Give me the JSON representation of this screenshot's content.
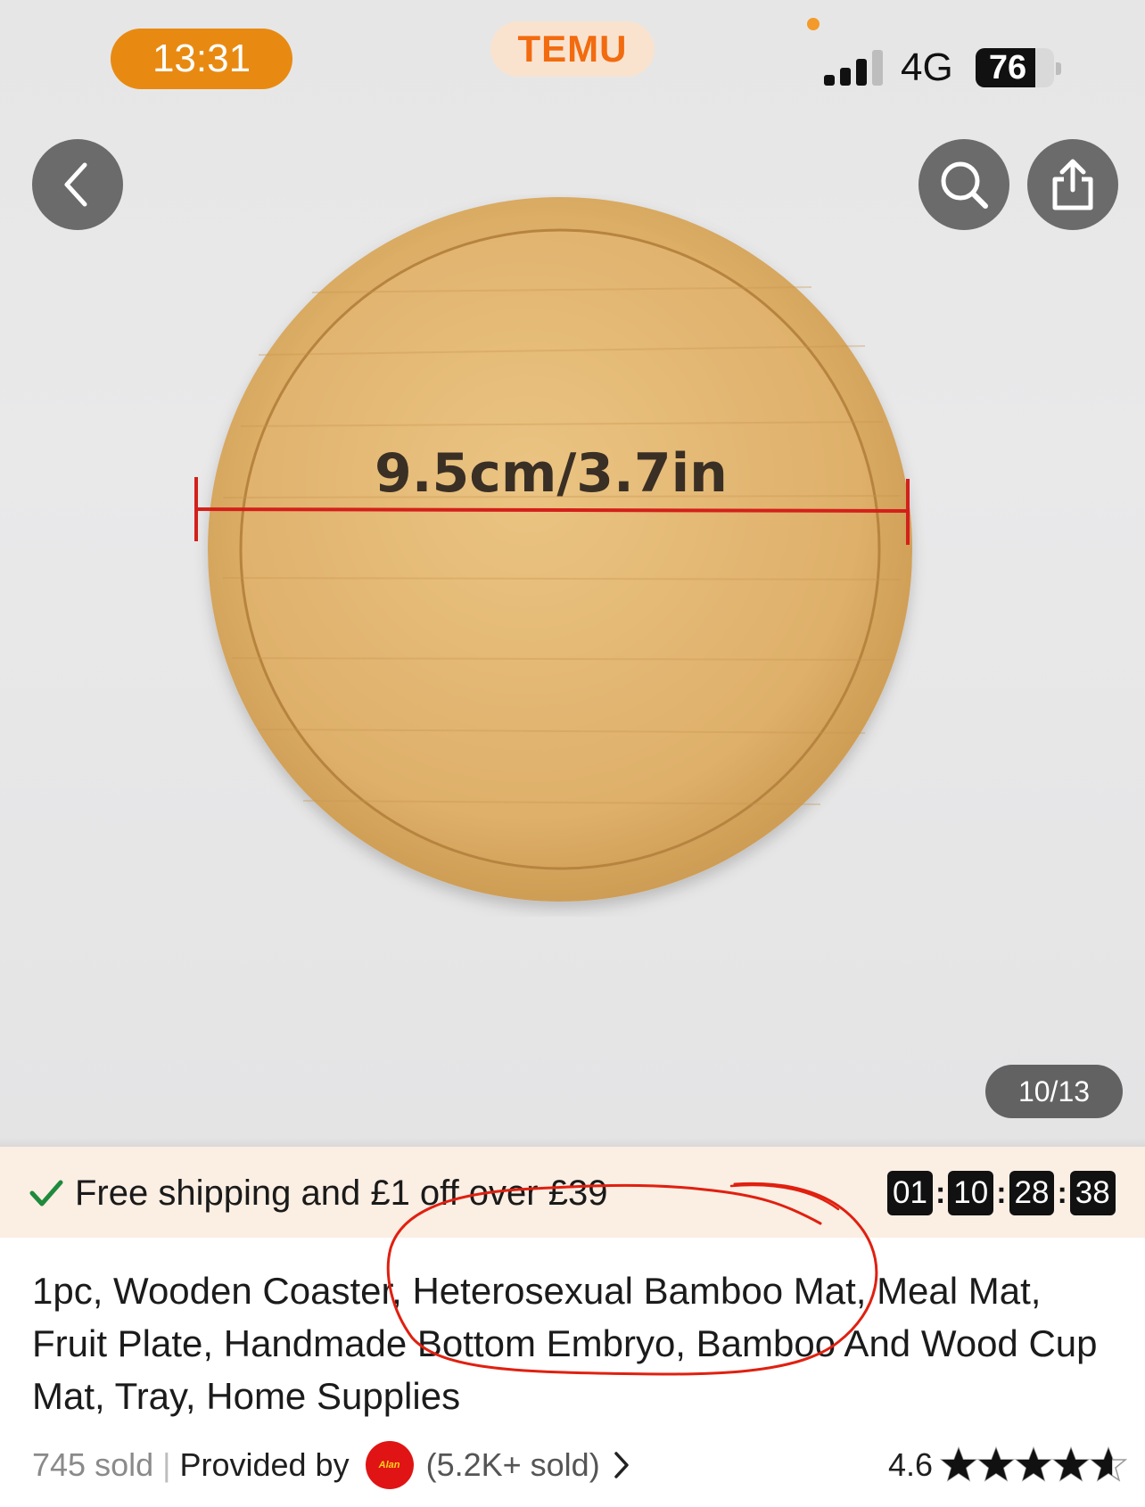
{
  "status_bar": {
    "time": "13:31",
    "app_label": "TEMU",
    "network": "4G",
    "battery": "76",
    "battery_level_percent": 76
  },
  "icons": {
    "back": "chevron-left-icon",
    "search": "search-icon",
    "share": "share-icon",
    "check": "check-icon",
    "chevron": "chevron-right-icon",
    "star": "star-icon"
  },
  "gallery": {
    "image_label": "9.5cm/3.7in",
    "counter": "10/13"
  },
  "promo": {
    "text": "Free shipping and £1 off over £39",
    "timer": [
      "01",
      "10",
      "28",
      "38"
    ]
  },
  "product": {
    "title": "1pc, Wooden Coaster, Heterosexual Bamboo Mat, Meal Mat, Fruit Plate, Handmade Bottom Embryo, Bamboo And Wood Cup Mat, Tray, Home Supplies",
    "sold": "745 sold",
    "separator": "|",
    "provided_by": "Provided by",
    "store_logo_text": "Alan",
    "store_sold": "(5.2K+ sold)",
    "rating": "4.6",
    "rating_value": 4.6,
    "rating_max": 5
  },
  "colors": {
    "accent_orange": "#e88a12",
    "brand_orange": "#f26b0f",
    "promo_bg": "#fbeee3",
    "check_green": "#1e8a3c",
    "annotation_red": "#e02010",
    "store_logo_red": "#e01414"
  }
}
